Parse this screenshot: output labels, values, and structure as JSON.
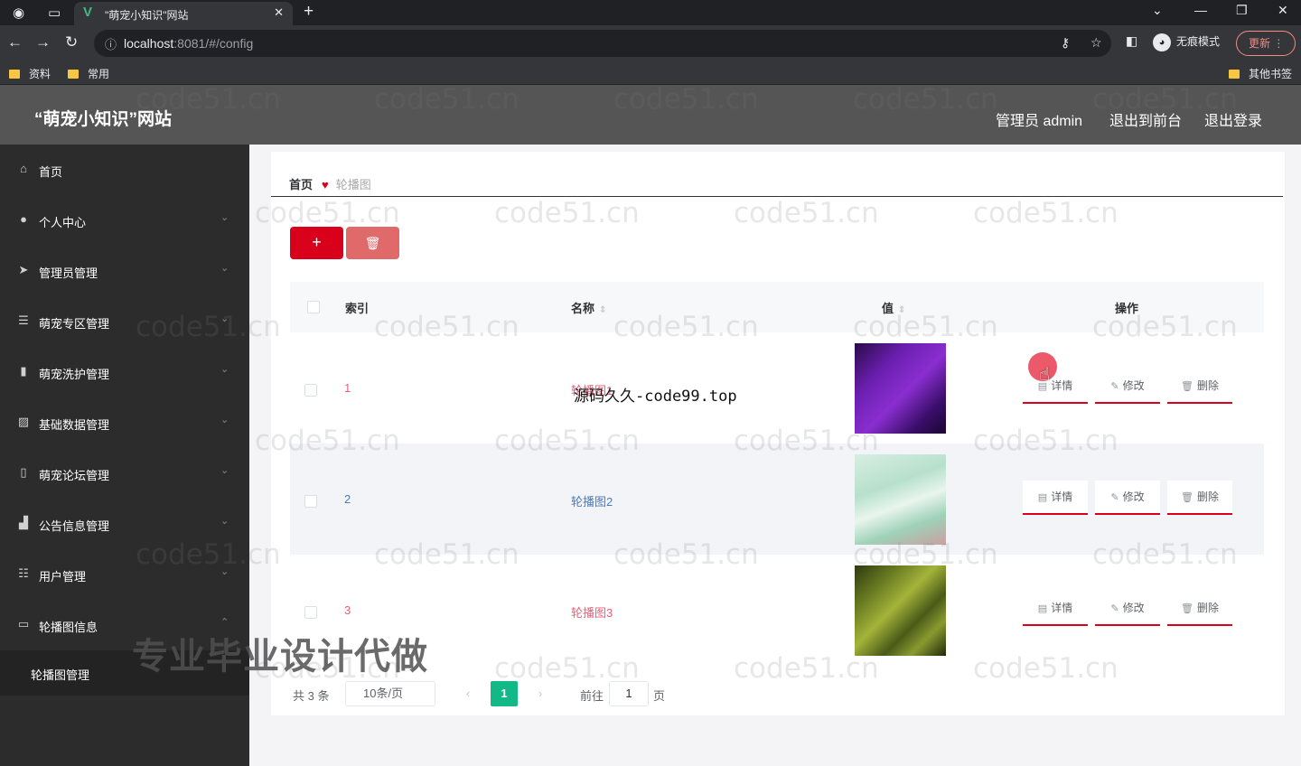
{
  "browser": {
    "tab_title": "\"萌宠小知识\"网站",
    "url_host": "localhost",
    "url_rest": ":8081/#/config",
    "incognito_label": "无痕模式",
    "update_label": "更新",
    "bookmarks": [
      "资料",
      "常用"
    ],
    "other_bookmarks": "其他书签"
  },
  "header": {
    "title": "“萌宠小知识”网站",
    "admin_label": "管理员 admin",
    "to_frontend": "退出到前台",
    "logout": "退出登录"
  },
  "sidebar": {
    "items": [
      {
        "label": "首页",
        "icon": "home-icon"
      },
      {
        "label": "个人中心",
        "icon": "user-icon"
      },
      {
        "label": "管理员管理",
        "icon": "send-icon"
      },
      {
        "label": "萌宠专区管理",
        "icon": "list-icon"
      },
      {
        "label": "萌宠洗护管理",
        "icon": "columns-icon"
      },
      {
        "label": "基础数据管理",
        "icon": "chart-icon"
      },
      {
        "label": "萌宠论坛管理",
        "icon": "phone-icon"
      },
      {
        "label": "公告信息管理",
        "icon": "bar-chart-icon"
      },
      {
        "label": "用户管理",
        "icon": "sliders-icon"
      },
      {
        "label": "轮播图信息",
        "icon": "card-icon"
      }
    ],
    "submenu": "轮播图管理"
  },
  "breadcrumb": {
    "home": "首页",
    "current": "轮播图"
  },
  "table": {
    "headers": {
      "index": "索引",
      "name": "名称",
      "value": "值",
      "actions": "操作"
    },
    "rows": [
      {
        "index": "1",
        "name": "轮播图1",
        "text_color": "#e8607a"
      },
      {
        "index": "2",
        "name": "轮播图2",
        "text_color": "#4a7bbd"
      },
      {
        "index": "3",
        "name": "轮播图3",
        "text_color": "#e8607a"
      }
    ],
    "actions": {
      "detail": "详情",
      "edit": "修改",
      "delete": "删除"
    }
  },
  "pagination": {
    "total": "共 3 条",
    "page_size": "10条/页",
    "current_page": "1",
    "goto_label": "前往",
    "goto_value": "1",
    "page_suffix": "页"
  },
  "watermark": "code51.cn",
  "overlay": {
    "site": "源码久久-code99.top",
    "banner": "专业毕业设计代做"
  },
  "colors": {
    "accent": "#d9001b",
    "pager_active": "#12b886",
    "sidebar_bg": "#2c2c2c",
    "header_bg": "#555555"
  }
}
